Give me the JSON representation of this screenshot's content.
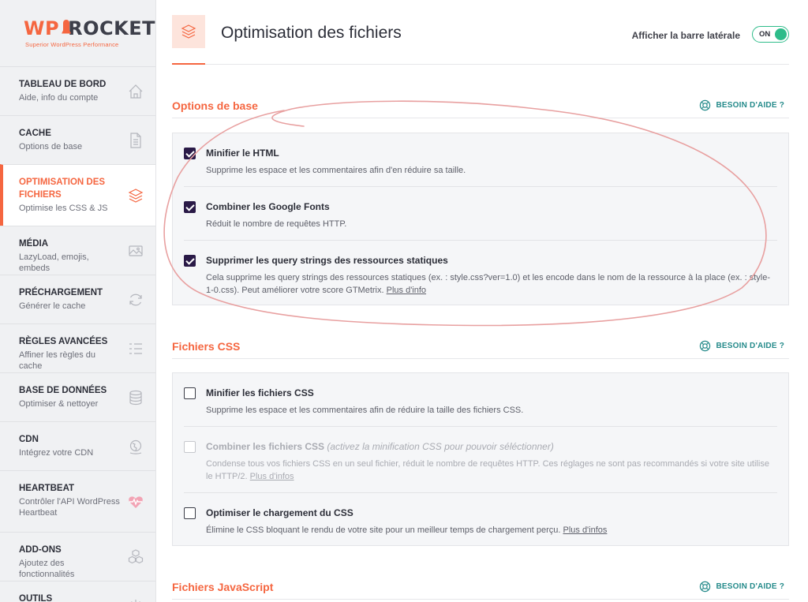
{
  "brand": {
    "logo_wp": "WP",
    "logo_rocket": "ROCKET",
    "tagline": "Superior WordPress Performance"
  },
  "sidebar": {
    "items": [
      {
        "title": "TABLEAU DE BORD",
        "desc": "Aide, info du compte",
        "icon": "home-icon"
      },
      {
        "title": "CACHE",
        "desc": "Options de base",
        "icon": "file-icon"
      },
      {
        "title": "OPTIMISATION DES FICHIERS",
        "desc": "Optimise les CSS & JS",
        "icon": "layers-icon"
      },
      {
        "title": "MÉDIA",
        "desc": "LazyLoad, emojis, embeds",
        "icon": "image-icon"
      },
      {
        "title": "PRÉCHARGEMENT",
        "desc": "Générer le cache",
        "icon": "refresh-icon"
      },
      {
        "title": "RÈGLES AVANCÉES",
        "desc": "Affiner les règles du cache",
        "icon": "list-icon"
      },
      {
        "title": "BASE DE DONNÉES",
        "desc": "Optimiser & nettoyer",
        "icon": "database-icon"
      },
      {
        "title": "CDN",
        "desc": "Intégrez votre CDN",
        "icon": "globe-icon"
      },
      {
        "title": "HEARTBEAT",
        "desc": "Contrôler l'API WordPress Heartbeat",
        "icon": "heartbeat-icon"
      },
      {
        "title": "ADD-ONS",
        "desc": "Ajoutez des fonctionnalités",
        "icon": "cubes-icon"
      },
      {
        "title": "OUTILS",
        "desc": "",
        "icon": "tools-icon"
      }
    ]
  },
  "header": {
    "title": "Optimisation des fichiers",
    "sidebar_toggle_label": "Afficher la barre latérale",
    "toggle_state": "ON"
  },
  "sections": {
    "basic": {
      "title": "Options de base",
      "help": "BESOIN D'AIDE ?",
      "options": [
        {
          "label": "Minifier le HTML",
          "desc": "Supprime les espace et les commentaires afin d'en réduire sa taille.",
          "checked": true
        },
        {
          "label": "Combiner les Google Fonts",
          "desc": "Réduit le nombre de requêtes HTTP.",
          "checked": true
        },
        {
          "label": "Supprimer les query strings des ressources statiques",
          "desc": "Cela supprime les query strings des ressources statiques (ex. : style.css?ver=1.0) et les encode dans le nom de la ressource à la place (ex. : style-1-0.css). Peut améliorer votre score GTMetrix.",
          "link": "Plus d'info",
          "checked": true
        }
      ]
    },
    "css": {
      "title": "Fichiers CSS",
      "help": "BESOIN D'AIDE ?",
      "options": [
        {
          "label": "Minifier les fichiers CSS",
          "desc": "Supprime les espace et les commentaires afin de réduire la taille des fichiers CSS.",
          "checked": false
        },
        {
          "label": "Combiner les fichiers CSS",
          "note": "(activez la minification CSS pour pouvoir séléctionner)",
          "desc": "Condense tous vos fichiers CSS en un seul fichier, réduit le nombre de requêtes HTTP. Ces réglages ne sont pas recommandés si votre site utilise le HTTP/2.",
          "link": "Plus d'infos",
          "checked": false,
          "disabled": true
        },
        {
          "label": "Optimiser le chargement du CSS",
          "desc": "Élimine le CSS bloquant le rendu de votre site pour un meilleur temps de chargement perçu.",
          "link": "Plus d'infos",
          "checked": false
        }
      ]
    },
    "js": {
      "title": "Fichiers JavaScript",
      "help": "BESOIN D'AIDE ?"
    }
  },
  "colors": {
    "accent": "#f56640",
    "toggle_on": "#2ebc8a",
    "help_link": "#248a8a",
    "checkbox_checked": "#2a1a47",
    "annotation": "#e8a0a0"
  }
}
